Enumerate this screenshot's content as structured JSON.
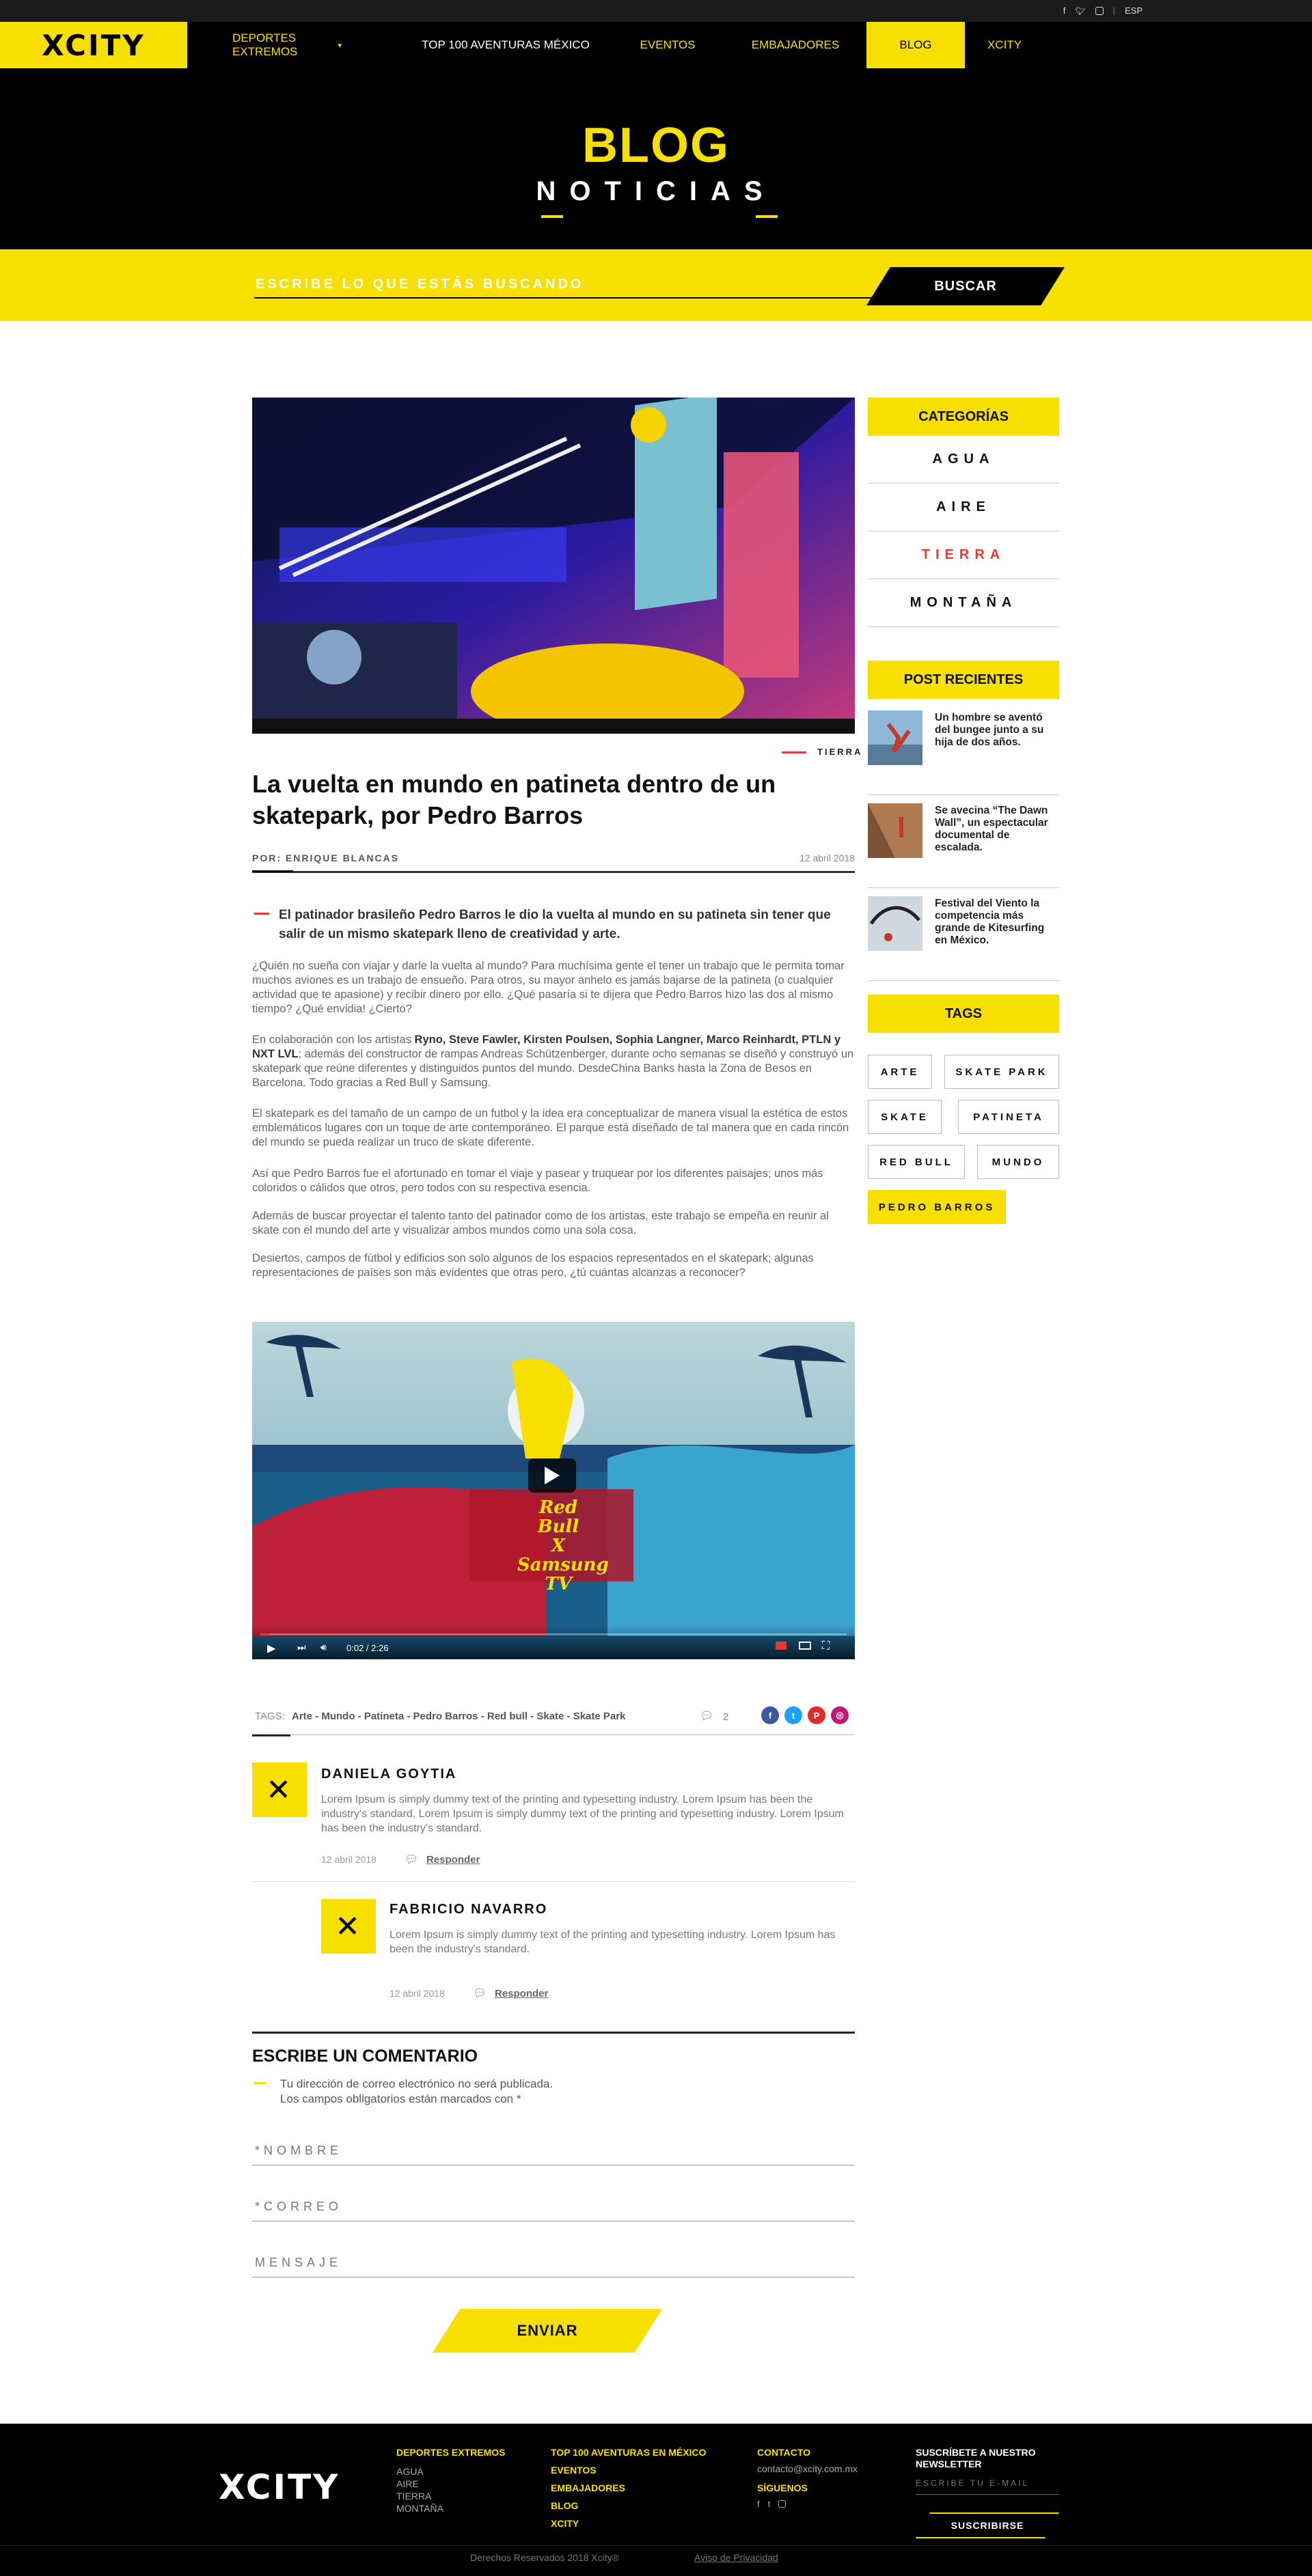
{
  "topbar": {
    "lang": "ESP",
    "socials": [
      "f",
      "t",
      "ig"
    ]
  },
  "brand": {
    "logo": "XCITY"
  },
  "nav": {
    "items": [
      {
        "label": "DEPORTES EXTREMOS"
      },
      {
        "label": "TOP 100 AVENTURAS MÉXICO"
      },
      {
        "label": "EVENTOS"
      },
      {
        "label": "EMBAJADORES"
      },
      {
        "label": "BLOG"
      },
      {
        "label": "XCITY"
      }
    ]
  },
  "hero": {
    "title": "BLOG",
    "subtitle": "NOTICIAS"
  },
  "search": {
    "placeholder": "ESCRIBE LO QUE ESTÁS BUSCANDO",
    "button": "BUSCAR"
  },
  "article": {
    "category": "TIERRA",
    "title": "La vuelta en mundo en patineta dentro de un skatepark, por Pedro Barros",
    "author": "POR: ENRIQUE BLANCAS",
    "date": "12 abril 2018",
    "lead": "El patinador brasileño Pedro Barros le dio la vuelta al mundo en su patineta sin tener que salir de un mismo skatepark lleno de creatividad y arte.",
    "p1": "¿Quién no sueña con viajar y darle la vuelta al mundo? Para muchísima gente el tener un trabajo que le permita tomar muchos aviones es un trabajo de ensueño. Para otros, su mayor anhelo es jamás bajarse de la patineta (o cualquier actividad que te apasione) y recibir dinero por ello. ¿Qué pasaría si te dijera que Pedro Barros hizo las dos al mismo tiempo? ¿Qué envidia! ¿Cierto?",
    "p2_pre": "En colaboración con los artistas ",
    "p2_bold": "Ryno, Steve Fawler, Kirsten Poulsen, Sophia Langner, Marco Reinhardt, PTLN y NXT LVL",
    "p2_post": "; además del constructor de rampas Andreas Schützenberger, durante ocho semanas se diseñó y construyó un skatepark que reúne diferentes y distinguidos puntos del mundo. DesdeChina Banks hasta la Zona de Besos en Barcelona. Todo gracias a Red Bull y Samsung.",
    "p3": "El skatepark es del tamaño de un campo de un futbol y la idea era conceptualizar de manera visual la estética de estos emblemáticos lugares con un toque de arte contemporáneo. El parque está diseñado de tal manera que en cada rincón del mundo se pueda realizar un truco de skate diferente.",
    "p4": "Así que Pedro Barros fue el afortunado en tomar el viaje y pasear y truquear por los diferentes paisajes; unos más coloridos o cálidos que otros, pero todos con su respectiva esencia.",
    "p5": "Además de buscar proyectar el talento tanto del patinador como de los artistas, este trabajo se empeña en reunir al skate con el mundo del arte y visualizar ambos mundos como una sola cosa.",
    "p6": "Desiertos, campos de fútbol y edificios son solo algunos de los espacios representados en el skatepark; algunas representaciones de países son más evidentes que otras pero, ¿tú cuántas alcanzas a reconocer?"
  },
  "video": {
    "title_line1": "Red Bull",
    "title_line2": "X",
    "title_line3": "Samsung TV",
    "time": "0:02 / 2:26",
    "progress": 0.015
  },
  "tags_row": {
    "label": "TAGS:",
    "list": "Arte - Mundo - Patineta - Pedro Barros - Red bull - Skate - Skate Park",
    "comments": "2"
  },
  "comments": [
    {
      "name": "DANIELA GOYTIA",
      "text": "Lorem Ipsum is simply dummy text of the printing and typesetting industry. Lorem Ipsum has been the industry's standard. Lorem Ipsum is simply dummy text of the printing and typesetting industry. Lorem Ipsum has been the industry's standard.",
      "date": "12 abril 2018",
      "reply": "Responder"
    },
    {
      "name": "FABRICIO NAVARRO",
      "text": "Lorem Ipsum is simply dummy text of the printing and typesetting industry. Lorem Ipsum has been the industry's standard.",
      "date": "12 abril 2018",
      "reply": "Responder"
    }
  ],
  "form": {
    "title": "ESCRIBE UN COMENTARIO",
    "note1": "Tu dirección de correo electrónico no será publicada.",
    "note2": "Los campos obligatorios están marcados con *",
    "name": "*NOMBRE",
    "email": "*CORREO",
    "message": "MENSAJE",
    "send": "ENVIAR"
  },
  "sidebar": {
    "categories_title": "CATEGORÍAS",
    "categories": [
      "AGUA",
      "AIRE",
      "TIERRA",
      "MONTAÑA"
    ],
    "recent_title": "POST RECIENTES",
    "recent": [
      "Un hombre se aventó del bungee junto a su hija de dos años.",
      "Se avecina “The Dawn Wall”, un espectacular documental de escalada.",
      "Festival del Viento la competencia más grande de Kitesurfing en México."
    ],
    "tags_title": "TAGS",
    "tags": [
      "ARTE",
      "SKATE PARK",
      "SKATE",
      "PATINETA",
      "RED BULL",
      "MUNDO",
      "PEDRO BARROS"
    ]
  },
  "footer": {
    "logo": "XCITY",
    "col1_title": "DEPORTES EXTREMOS",
    "col1_items": [
      "AGUA",
      "AIRE",
      "TIERRA",
      "MONTAÑA"
    ],
    "col2_title": "TOP 100 AVENTURAS EN MÉXICO",
    "col2_items": [
      "EVENTOS",
      "EMBAJADORES",
      "BLOG",
      "XCITY"
    ],
    "contact_title": "CONTACTO",
    "contact_email": "contacto@xcity.com.mx",
    "follow_title": "SÍGUENOS",
    "newsletter_title": "SUSCRÍBETE A NUESTRO NEWSLETTER",
    "newsletter_placeholder": "ESCRIBE TU E-MAIL",
    "newsletter_button": "SUSCRIBIRSE",
    "copyright": "Derechos Reservados 2018 Xcity®",
    "privacy": "Aviso de Privacidad"
  },
  "colors": {
    "accent": "#f7e000",
    "red": "#e53935",
    "black": "#000000"
  }
}
